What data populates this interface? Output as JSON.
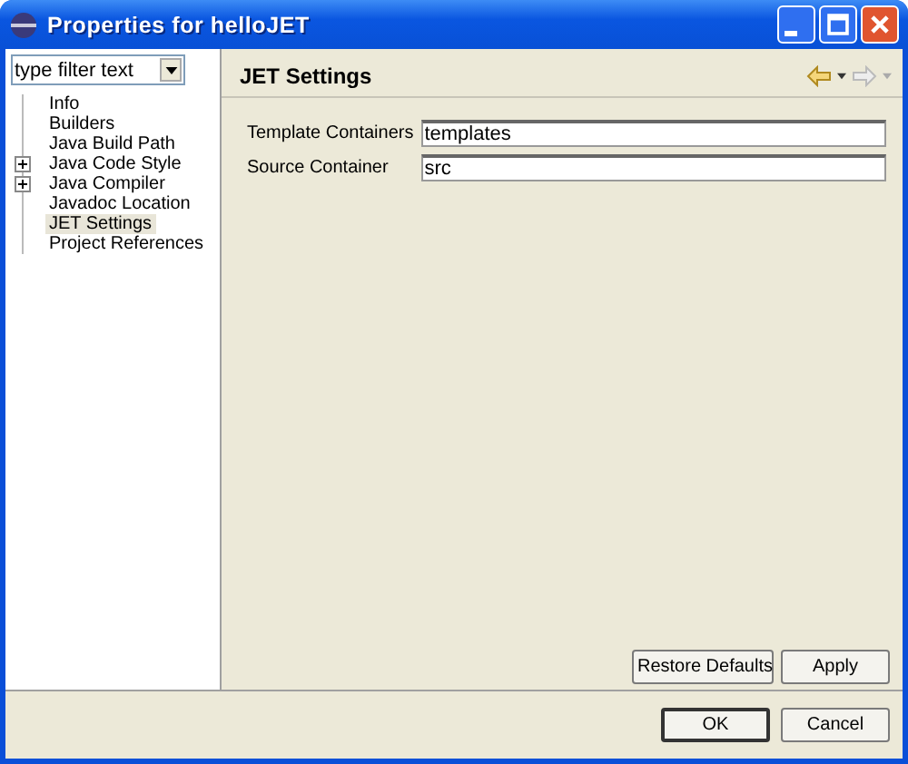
{
  "window": {
    "title": "Properties for helloJET"
  },
  "filter": {
    "placeholder": "type filter text"
  },
  "tree": [
    {
      "label": "Info",
      "selected": false
    },
    {
      "label": "Builders",
      "selected": false
    },
    {
      "label": "Java Build Path",
      "selected": false
    },
    {
      "label": "Java Code Style",
      "selected": false,
      "expanded": false
    },
    {
      "label": "Java Compiler",
      "selected": false,
      "expanded": false
    },
    {
      "label": "Javadoc Location",
      "selected": false
    },
    {
      "label": "JET Settings",
      "selected": true
    },
    {
      "label": "Project References",
      "selected": false
    }
  ],
  "page": {
    "title": "JET Settings",
    "fields": [
      {
        "label": "Template Containers",
        "value": "templates"
      },
      {
        "label": "Source Container",
        "value": "src"
      }
    ],
    "buttons": [
      "Restore Defaults",
      "Apply"
    ]
  },
  "dialog_buttons": [
    {
      "label": "OK",
      "default": true
    },
    {
      "label": "Cancel",
      "default": false
    }
  ]
}
